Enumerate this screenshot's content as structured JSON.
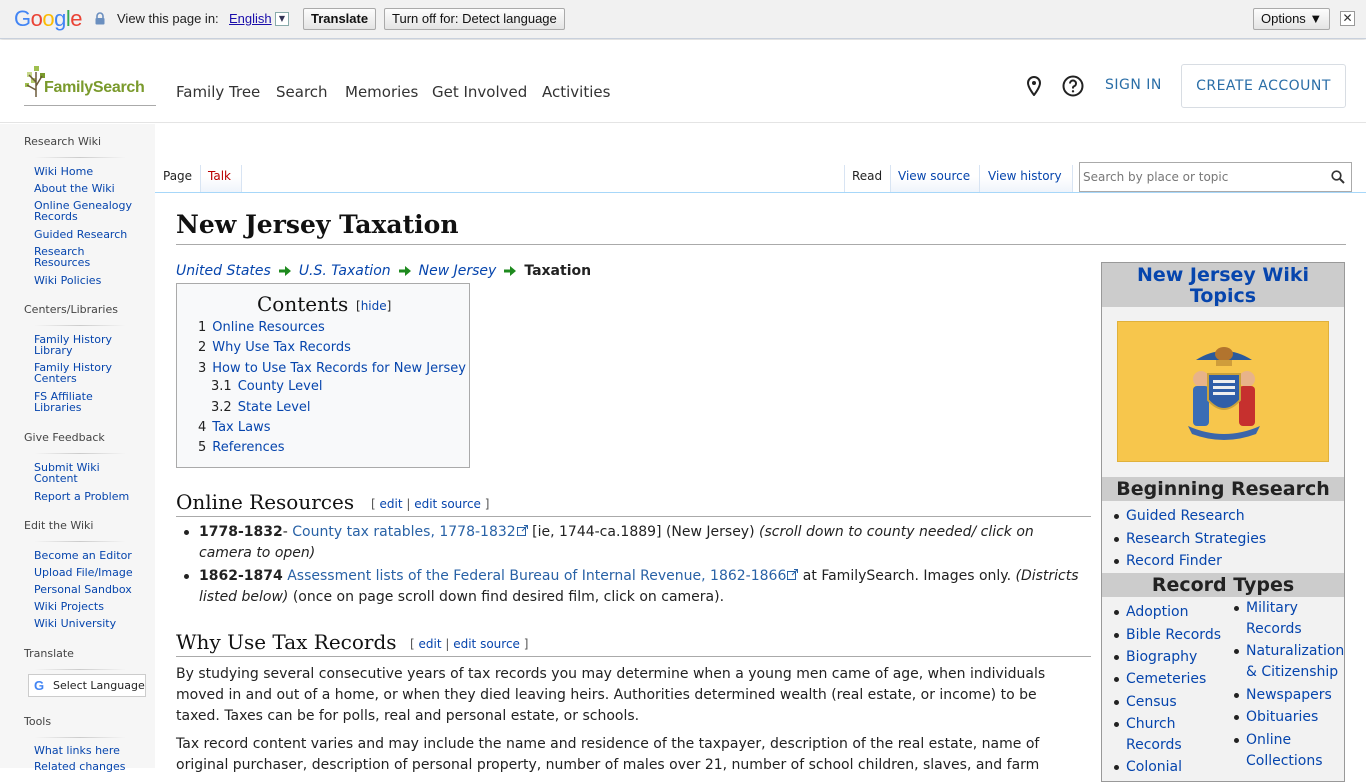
{
  "translate_bar": {
    "google": [
      "G",
      "o",
      "o",
      "g",
      "l",
      "e"
    ],
    "view_text": "View this page in:",
    "language": "English",
    "translate_button": "Translate",
    "turn_off_button": "Turn off for: Detect language",
    "options_button": "Options ▼",
    "close": "✕"
  },
  "header": {
    "logo_text": "FamilySearch",
    "nav": [
      "Family Tree",
      "Search",
      "Memories",
      "Get Involved",
      "Activities"
    ],
    "sign_in": "SIGN IN",
    "create_account": "CREATE ACCOUNT"
  },
  "sidebar": {
    "sections": [
      {
        "heading": "Research Wiki",
        "items": [
          "Wiki Home",
          "About the Wiki",
          "Online Genealogy Records",
          "Guided Research",
          "Research Resources",
          "Wiki Policies"
        ]
      },
      {
        "heading": "Centers/Libraries",
        "items": [
          "Family History Library",
          "Family History Centers",
          "FS Affiliate Libraries"
        ]
      },
      {
        "heading": "Give Feedback",
        "items": [
          "Submit Wiki Content",
          "Report a Problem"
        ]
      },
      {
        "heading": "Edit the Wiki",
        "items": [
          "Become an Editor",
          "Upload File/Image",
          "Personal Sandbox",
          "Wiki Projects",
          "Wiki University"
        ]
      },
      {
        "heading": "Translate",
        "items": []
      },
      {
        "heading": "Tools",
        "items": [
          "What links here",
          "Related changes"
        ]
      }
    ],
    "select_language": "Select Language"
  },
  "tabs": {
    "page": "Page",
    "talk": "Talk",
    "read": "Read",
    "view_source": "View source",
    "view_history": "View history",
    "search_placeholder": "Search by place or topic"
  },
  "article": {
    "title": "New Jersey Taxation",
    "breadcrumbs": [
      "United States",
      "U.S. Taxation",
      "New Jersey"
    ],
    "breadcrumb_current": "Taxation",
    "toc": {
      "title": "Contents",
      "hide": "hide",
      "items": [
        {
          "num": "1",
          "text": "Online Resources"
        },
        {
          "num": "2",
          "text": "Why Use Tax Records"
        },
        {
          "num": "3",
          "text": "How to Use Tax Records for New Jersey"
        },
        {
          "num": "3.1",
          "text": "County Level"
        },
        {
          "num": "3.2",
          "text": "State Level"
        },
        {
          "num": "4",
          "text": "Tax Laws"
        },
        {
          "num": "5",
          "text": "References"
        }
      ]
    },
    "edit": "edit",
    "edit_source": "edit source",
    "sections": {
      "online": {
        "heading": "Online Resources",
        "items": [
          {
            "bold": "1778-1832",
            "dash": "- ",
            "link": "County tax ratables, 1778-1832",
            "rest": " [ie, 1744-ca.1889] (New Jersey) ",
            "italic": "(scroll down to county needed/ click on camera to open)",
            "tail": ""
          },
          {
            "bold": "1862-1874",
            "dash": " ",
            "link": "Assessment lists of the Federal Bureau of Internal Revenue, 1862-1866",
            "rest": " at FamilySearch. Images only. ",
            "italic": "(Districts listed below)",
            "tail": " (once on page scroll down find desired film, click on camera)."
          }
        ]
      },
      "why": {
        "heading": "Why Use Tax Records",
        "para1": "By studying several consecutive years of tax records you may determine when a young men came of age, when individuals moved in and out of a home, or when they died leaving heirs. Authorities determined wealth (real estate, or income) to be taxed. Taxes can be for polls, real and personal estate, or schools.",
        "para2": "Tax record content varies and may include the name and residence of the taxpayer, description of the real estate, name of original purchaser, description of personal property, number of males over 21, number of school children, slaves, and farm"
      }
    }
  },
  "infobox": {
    "title": "New Jersey Wiki Topics",
    "beginning_heading": "Beginning Research",
    "beginning_items": [
      "Guided Research",
      "Research Strategies",
      "Record Finder"
    ],
    "record_types_heading": "Record Types",
    "col1": [
      "Adoption",
      "Bible Records",
      "Biography",
      "Cemeteries",
      "Census",
      "Church Records",
      "Colonial"
    ],
    "col2": [
      "Military Records",
      "Naturalization & Citizenship",
      "Newspapers",
      "Obituaries",
      "Online Collections"
    ]
  },
  "colors": {
    "link": "#0645ad",
    "accent_blue": "#2a6ea7",
    "logo_green": "#7a9a2c",
    "flag_buff": "#f7c64c"
  }
}
